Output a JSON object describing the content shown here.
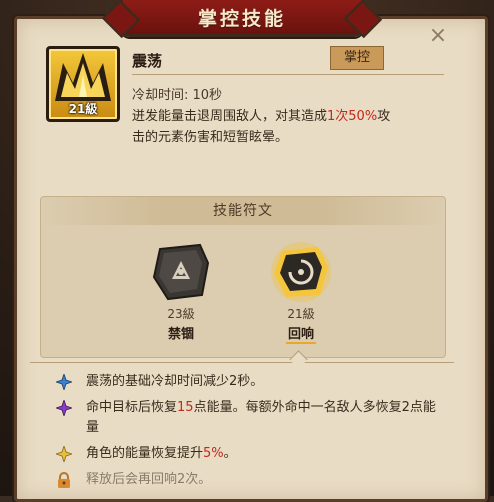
{
  "header": {
    "title": "掌控技能",
    "close_glyph": "×"
  },
  "skill": {
    "icon": "golden-crown-spikes-icon",
    "level": "21級",
    "name": "震荡",
    "type_badge": "掌控",
    "cooldown": "冷却时间: 10秒",
    "desc_line1_before": "迸发能量击退周围敌人，对其造成",
    "desc_line1_highlight": "1次50%",
    "desc_line1_after": "攻",
    "desc_line2": "击的元素伤害和短暂眩晕。"
  },
  "runes": {
    "header": "技能符文",
    "items": [
      {
        "icon": "dark-stone-rune-icon",
        "level": "23級",
        "name": "禁锢",
        "active": false
      },
      {
        "icon": "glowing-swirl-rune-icon",
        "level": "21級",
        "name": "回响",
        "active": true
      }
    ]
  },
  "effects": [
    {
      "icon": "blue-star-icon",
      "color": "#3a7fd0",
      "before": "震荡的基础冷却时间减少2秒。",
      "highlight": "",
      "after": ""
    },
    {
      "icon": "purple-star-icon",
      "color": "#8a3cc8",
      "before": "命中目标后恢复",
      "highlight": "15",
      "after": "点能量。每额外命中一名敌人多恢复2点能量"
    },
    {
      "icon": "gold-star-icon",
      "color": "#d4a020",
      "before": "角色的能量恢复提升",
      "highlight": "5%",
      "after": "。"
    },
    {
      "icon": "lock-icon",
      "color": "#c87a28",
      "before": "释放后会再回响2次。",
      "highlight": "",
      "after": ""
    }
  ],
  "colors": {
    "highlight": "#c2291d",
    "panel": "#e9dcc4",
    "banner": "#8e1c16"
  }
}
